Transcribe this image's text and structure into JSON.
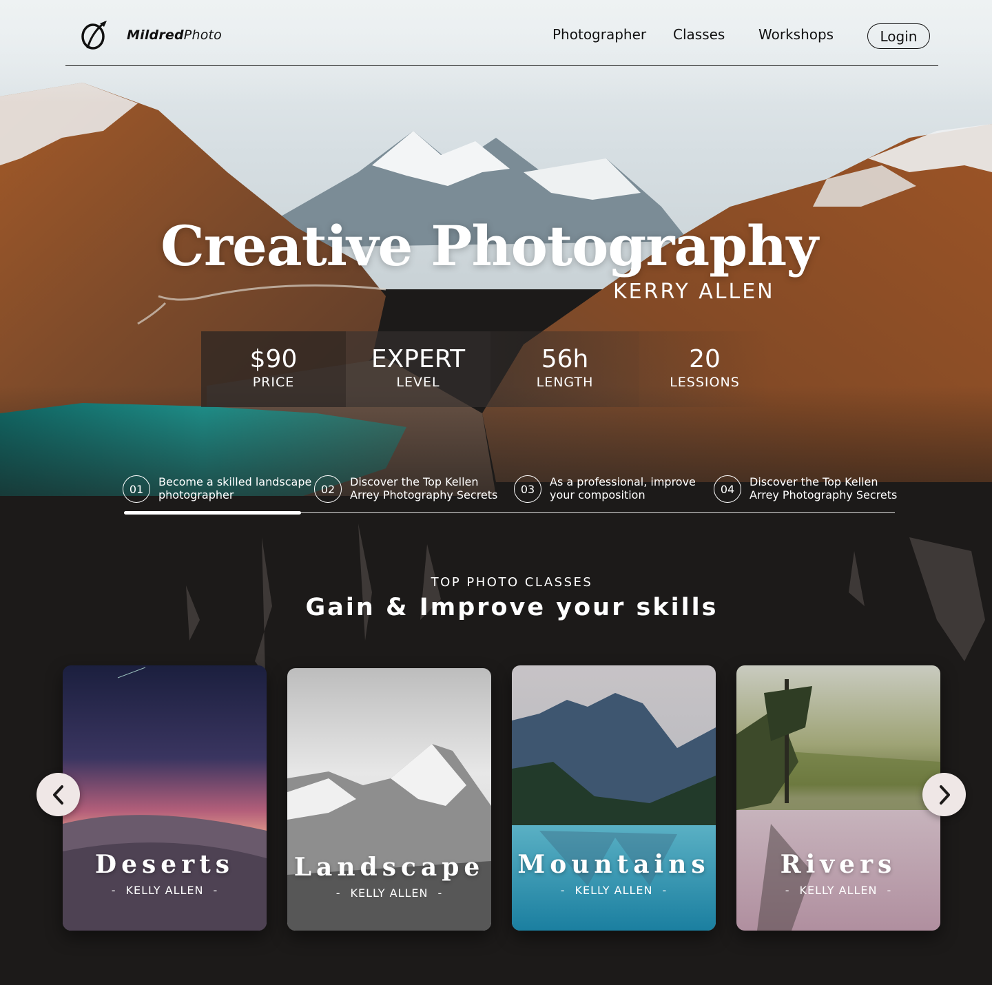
{
  "header": {
    "brand_bold": "Mildred",
    "brand_light": "Photo",
    "nav": [
      "Photographer",
      "Classes",
      "Workshops"
    ],
    "login_label": "Login"
  },
  "hero": {
    "title": "Creative Photography",
    "author": "KERRY ALLEN",
    "stats": [
      {
        "value": "$90",
        "label": "PRICE"
      },
      {
        "value": "EXPERT",
        "label": "LEVEL"
      },
      {
        "value": "56h",
        "label": "LENGTH"
      },
      {
        "value": "20",
        "label": "LESSIONS"
      }
    ],
    "steps": [
      {
        "num": "01",
        "text": "Become a skilled landscape photographer"
      },
      {
        "num": "02",
        "text": "Discover the Top Kellen Arrey Photography Secrets"
      },
      {
        "num": "03",
        "text": "As a professional, improve your composition"
      },
      {
        "num": "04",
        "text": "Discover the Top Kellen Arrey Photography Secrets"
      }
    ],
    "progress": 0.23
  },
  "classes": {
    "kicker": "TOP PHOTO CLASSES",
    "title": "Gain & Improve your skills",
    "cards": [
      {
        "title": "Deserts",
        "author": "KELLY ALLEN"
      },
      {
        "title": "Landscape",
        "author": "KELLY ALLEN"
      },
      {
        "title": "Mountains",
        "author": "KELLY ALLEN"
      },
      {
        "title": "Rivers",
        "author": "KELLY ALLEN"
      }
    ],
    "prev_icon": "chevron-left-icon",
    "next_icon": "chevron-right-icon"
  },
  "colors": {
    "dark_bg": "#1c1a19",
    "lake": "#1a8a86",
    "rust": "#8a4a22",
    "arrow_bg": "#efe7e6"
  }
}
